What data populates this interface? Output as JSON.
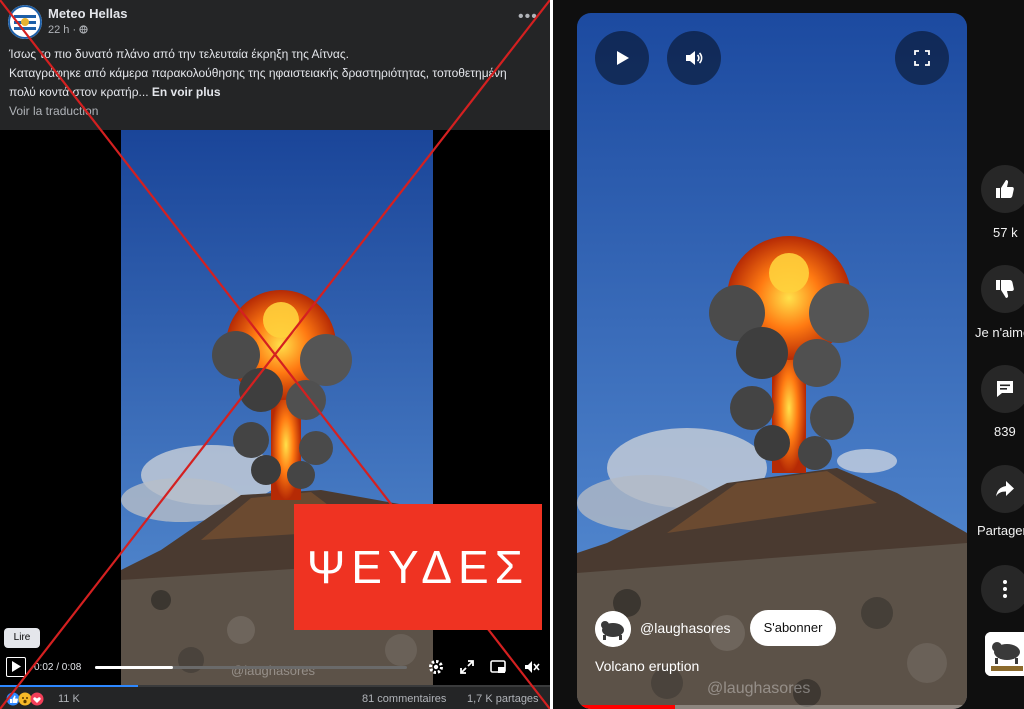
{
  "facebook_post": {
    "page_name": "Meteo Hellas",
    "time": "22 h ·",
    "caption_line1": "Ίσως το πιο δυνατό πλάνο από την τελευταία έκρηξη της Αίτνας.",
    "caption_line2": "Καταγράφηκε από κάμερα παρακολούθησης της ηφαιστειακής δραστηριότητας, τοποθετημένη",
    "caption_line3": "πολύ κοντά στον κρατήρ...",
    "see_more": "En voir plus",
    "translate": "Voir la traduction",
    "read_button": "Lire",
    "video_time": "0:02 / 0:08",
    "video_progress": 0.25,
    "reaction_count": "11 K",
    "comments": "81 commentaires",
    "shares": "1,7 K partages",
    "watermark": "@laughasores"
  },
  "stamp_text": "ΨΕΥΔΕΣ",
  "shorts": {
    "channel": "@laughasores",
    "subscribe": "S'abonner",
    "video_title": "Volcano eruption",
    "likes": "57 k",
    "dislike_label": "Je n'aime",
    "comment_count": "839",
    "share_label": "Partager",
    "watermark": "@laughasores",
    "progress": 0.25
  },
  "colors": {
    "stamp": "#ef3322",
    "cross": "#d42020",
    "fb_bg": "#242526",
    "sky_top": "#1f4fa5",
    "sky_bottom": "#4d8ad4",
    "fire": "#ff6a10"
  },
  "icons": [
    "play-icon",
    "volume-icon",
    "fullscreen-icon",
    "like-icon",
    "dislike-icon",
    "comment-icon",
    "share-icon",
    "more-icon",
    "settings-icon",
    "expand-icon",
    "pip-icon",
    "mute-icon"
  ]
}
